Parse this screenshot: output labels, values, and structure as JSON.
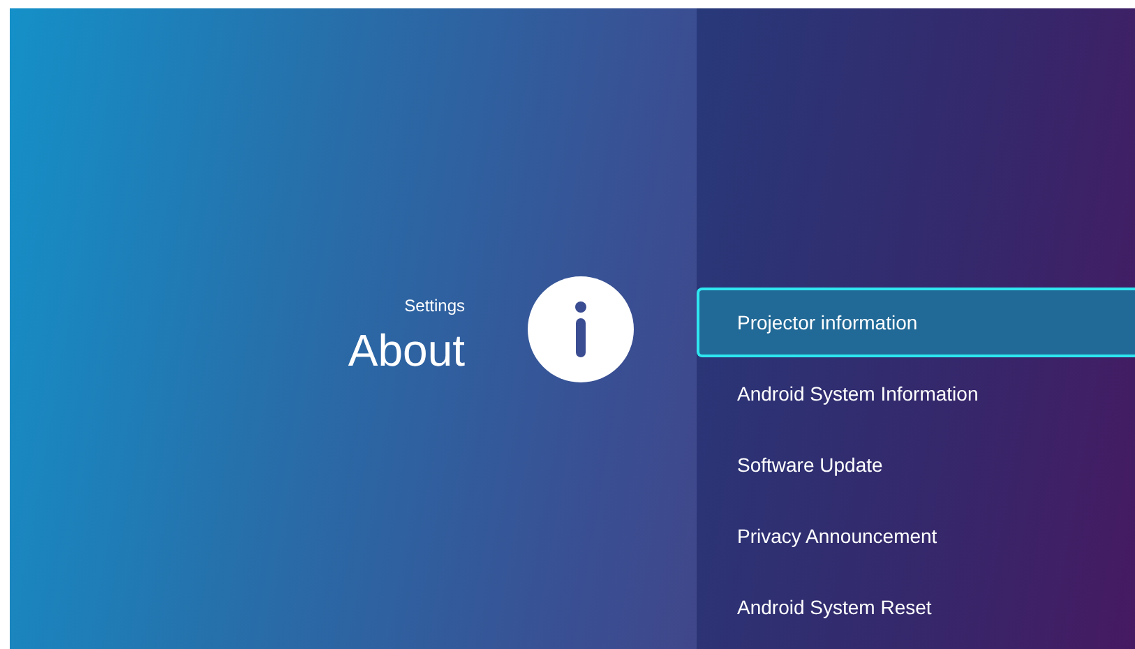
{
  "header": {
    "breadcrumb": "Settings",
    "title": "About"
  },
  "menu": [
    {
      "label": "Projector information",
      "selected": true
    },
    {
      "label": "Android System Information",
      "selected": false
    },
    {
      "label": "Software Update",
      "selected": false
    },
    {
      "label": "Privacy Announcement",
      "selected": false
    },
    {
      "label": "Android System Reset",
      "selected": false
    }
  ]
}
